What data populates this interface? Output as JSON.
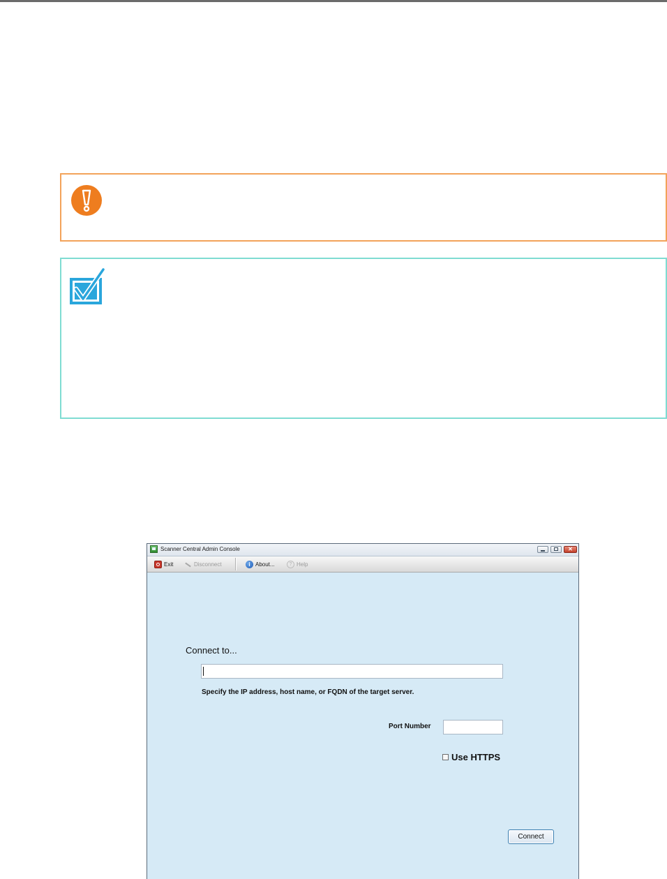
{
  "window": {
    "title": "Scanner Central Admin Console"
  },
  "toolbar": {
    "exit_label": "Exit",
    "disconnect_label": "Disconnect",
    "about_label": "About...",
    "help_label": "Help"
  },
  "form": {
    "heading": "Connect to...",
    "server_value": "",
    "server_help": "Specify the IP address, host name, or FQDN of the target server.",
    "port_label": "Port Number",
    "port_value": "",
    "https_label": "Use HTTPS",
    "https_checked": false,
    "connect_label": "Connect"
  },
  "icons": {
    "warning": "exclamation-icon",
    "hint": "checkmark-icon",
    "exit": "exit-icon",
    "disconnect": "disconnect-icon",
    "about": "info-icon",
    "help": "help-icon"
  },
  "colors": {
    "warning_border": "#f3a35a",
    "warning_icon": "#ee7d1f",
    "hint_border": "#7fdcd2",
    "hint_icon": "#2aa6dc",
    "window_body": "#d6eaf6"
  }
}
